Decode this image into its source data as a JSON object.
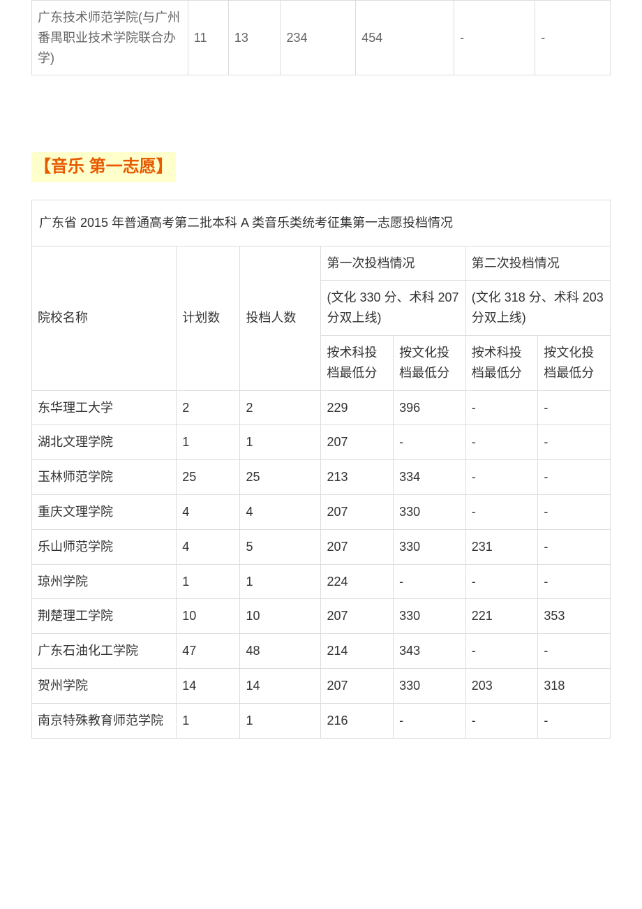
{
  "table1": {
    "row": {
      "name": "广东技术师范学院(与广州番禺职业技术学院联合办学)",
      "c1": "11",
      "c2": "13",
      "c3": "234",
      "c4": "454",
      "c5": "-",
      "c6": "-"
    }
  },
  "section_title": "【音乐 第一志愿】",
  "table2": {
    "caption": "广东省 2015 年普通高考第二批本科 A 类音乐类统考征集第一志愿投档情况",
    "headers": {
      "col_name": "院校名称",
      "col_plan": "计划数",
      "col_toudang": "投档人数",
      "group1_title": "第一次投档情况",
      "group1_sub": "(文化 330 分、术科 207 分双上线)",
      "group2_title": "第二次投档情况",
      "group2_sub": "(文化 318 分、术科 203 分双上线)",
      "g1c1": "按术科投档最低分",
      "g1c2": "按文化投档最低分",
      "g2c1": "按术科投档最低分",
      "g2c2": "按文化投档最低分"
    },
    "rows": [
      {
        "name": "东华理工大学",
        "plan": "2",
        "toudang": "2",
        "a": "229",
        "b": "396",
        "c": "-",
        "d": "-"
      },
      {
        "name": "湖北文理学院",
        "plan": "1",
        "toudang": "1",
        "a": "207",
        "b": "-",
        "c": "-",
        "d": "-"
      },
      {
        "name": "玉林师范学院",
        "plan": "25",
        "toudang": "25",
        "a": "213",
        "b": "334",
        "c": "-",
        "d": "-"
      },
      {
        "name": "重庆文理学院",
        "plan": "4",
        "toudang": "4",
        "a": "207",
        "b": "330",
        "c": "-",
        "d": "-"
      },
      {
        "name": "乐山师范学院",
        "plan": "4",
        "toudang": "5",
        "a": "207",
        "b": "330",
        "c": "231",
        "d": "-"
      },
      {
        "name": "琼州学院",
        "plan": "1",
        "toudang": "1",
        "a": "224",
        "b": "-",
        "c": "-",
        "d": "-"
      },
      {
        "name": "荆楚理工学院",
        "plan": "10",
        "toudang": "10",
        "a": "207",
        "b": "330",
        "c": "221",
        "d": "353"
      },
      {
        "name": "广东石油化工学院",
        "plan": "47",
        "toudang": "48",
        "a": "214",
        "b": "343",
        "c": "-",
        "d": "-"
      },
      {
        "name": "贺州学院",
        "plan": "14",
        "toudang": "14",
        "a": "207",
        "b": "330",
        "c": "203",
        "d": "318"
      },
      {
        "name": "南京特殊教育师范学院",
        "plan": "1",
        "toudang": "1",
        "a": "216",
        "b": "-",
        "c": "-",
        "d": "-"
      }
    ]
  }
}
